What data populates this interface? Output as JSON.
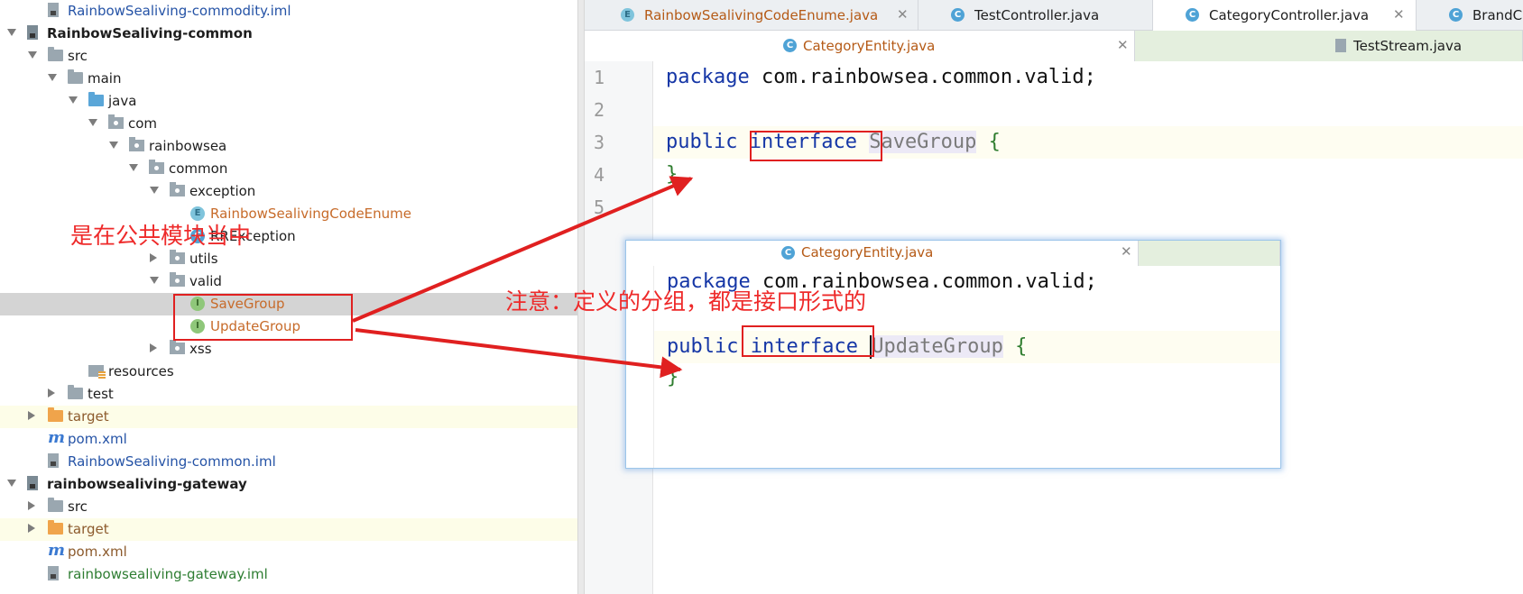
{
  "tree": {
    "rows": [
      {
        "label": "RainbowSealiving-commodity.iml",
        "icon": "iml",
        "style": "link",
        "indent": 53
      },
      {
        "label": "RainbowSealiving-common",
        "icon": "modf",
        "style": "bold",
        "indent": 30,
        "tw": "down"
      },
      {
        "label": "src",
        "icon": "folder",
        "style": "",
        "indent": 53,
        "tw": "down"
      },
      {
        "label": "main",
        "icon": "folder",
        "style": "",
        "indent": 75,
        "tw": "down"
      },
      {
        "label": "java",
        "icon": "folder-blue",
        "style": "",
        "indent": 98,
        "tw": "down"
      },
      {
        "label": "com",
        "icon": "pkg",
        "style": "",
        "indent": 120,
        "tw": "down"
      },
      {
        "label": "rainbowsea",
        "icon": "pkg",
        "style": "",
        "indent": 143,
        "tw": "down"
      },
      {
        "label": "common",
        "icon": "pkg",
        "style": "",
        "indent": 165,
        "tw": "down"
      },
      {
        "label": "exception",
        "icon": "pkg",
        "style": "",
        "indent": 188,
        "tw": "down"
      },
      {
        "label": "RainbowSealivingCodeEnume",
        "icon": "E",
        "style": "orange",
        "indent": 211
      },
      {
        "label": "RRException",
        "icon": "C",
        "style": "",
        "indent": 211
      },
      {
        "label": "utils",
        "icon": "pkg",
        "style": "",
        "indent": 188,
        "tw": "right"
      },
      {
        "label": "valid",
        "icon": "pkg",
        "style": "",
        "indent": 188,
        "tw": "down"
      },
      {
        "label": "SaveGroup",
        "icon": "I",
        "style": "orange",
        "indent": 211,
        "selected": true
      },
      {
        "label": "UpdateGroup",
        "icon": "I",
        "style": "orange",
        "indent": 211
      },
      {
        "label": "xss",
        "icon": "pkg",
        "style": "",
        "indent": 188,
        "tw": "right"
      },
      {
        "label": "resources",
        "icon": "res",
        "style": "",
        "indent": 98
      },
      {
        "label": "test",
        "icon": "folder",
        "style": "",
        "indent": 75,
        "tw": "right"
      },
      {
        "label": "target",
        "icon": "folder-orange",
        "style": "brown",
        "indent": 53,
        "tw": "right",
        "hl": true
      },
      {
        "label": "pom.xml",
        "icon": "m",
        "style": "link",
        "indent": 53
      },
      {
        "label": "RainbowSealiving-common.iml",
        "icon": "iml",
        "style": "link",
        "indent": 53
      },
      {
        "label": "rainbowsealiving-gateway",
        "icon": "modf",
        "style": "bold",
        "indent": 30,
        "tw": "down"
      },
      {
        "label": "src",
        "icon": "folder",
        "style": "",
        "indent": 53,
        "tw": "right"
      },
      {
        "label": "target",
        "icon": "folder-orange",
        "style": "brown",
        "indent": 53,
        "tw": "right",
        "hl": true
      },
      {
        "label": "pom.xml",
        "icon": "m",
        "style": "brown",
        "indent": 53
      },
      {
        "label": "rainbowsealiving-gateway.iml",
        "icon": "iml",
        "style": "green",
        "indent": 53
      }
    ]
  },
  "tabs_row1": [
    {
      "label": "RainbowSealivingCodeEnume.java",
      "icon": "E",
      "style": "orange",
      "closable": true
    },
    {
      "label": "TestController.java",
      "icon": "C",
      "style": "",
      "closable": false
    },
    {
      "label": "CategoryController.java",
      "icon": "C",
      "style": "",
      "closable": true
    },
    {
      "label": "BrandC",
      "icon": "C",
      "style": "",
      "closable": false
    }
  ],
  "tabs_row2": [
    {
      "label": "CategoryEntity.java",
      "icon": "C",
      "style": "orange",
      "closable": true
    },
    {
      "label": "TestStream.java",
      "icon": "J",
      "style": "",
      "closable": false
    }
  ],
  "editor": {
    "line_numbers": [
      "1",
      "2",
      "3",
      "4",
      "5"
    ],
    "line1": {
      "kw": "package",
      "rest": " com.rainbowsea.common.valid;"
    },
    "line3": {
      "kw": "public",
      "kw2": "interface",
      "name": "SaveGroup",
      "brace": "{"
    },
    "line4": {
      "brace": "}"
    }
  },
  "popup": {
    "tab_label": "CategoryEntity.java",
    "line1": {
      "kw": "package",
      "rest": " com.rainbowsea.common.valid;"
    },
    "line3": {
      "kw": "public",
      "kw2": "interface",
      "name": "UpdateGroup",
      "brace": "{"
    },
    "line4": {
      "brace": "}"
    }
  },
  "annotations": {
    "note_common": "是在公共模块当中",
    "note_interface": "注意：定义的分组，都是接口形式的",
    "color": "#e02020"
  }
}
